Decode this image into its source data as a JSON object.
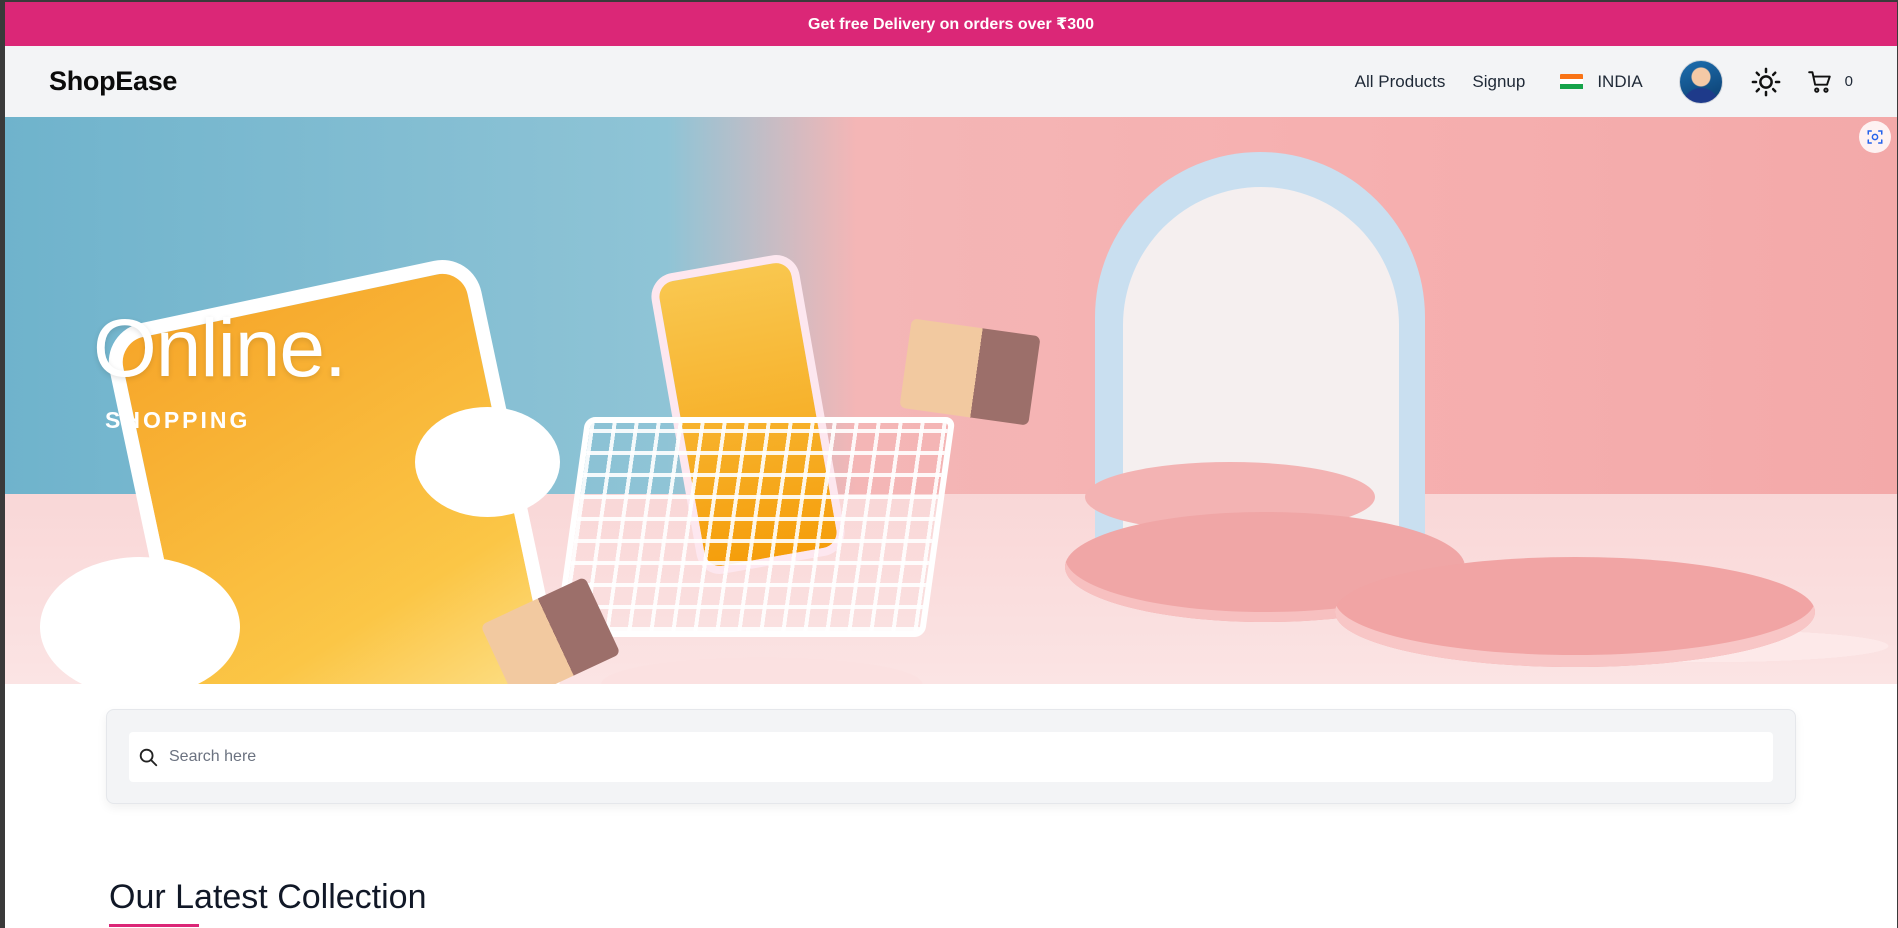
{
  "promo": {
    "text": "Get free Delivery on orders over ₹300",
    "background": "#db2777"
  },
  "header": {
    "logo": "ShopEase",
    "nav": [
      {
        "label": "All Products"
      },
      {
        "label": "Signup"
      }
    ],
    "country": {
      "label": "INDIA",
      "icon": "india-flag-icon"
    },
    "avatar": "user-avatar",
    "theme_icon": "sun-icon",
    "cart": {
      "icon": "cart-icon",
      "count": "0"
    }
  },
  "hero": {
    "title": "Online.",
    "subtitle": "SHOPPING",
    "scan_icon": "scan-icon"
  },
  "search": {
    "placeholder": "Search here",
    "value": "",
    "icon": "search-icon"
  },
  "collection": {
    "title": "Our Latest Collection",
    "accent": "#db2777"
  }
}
